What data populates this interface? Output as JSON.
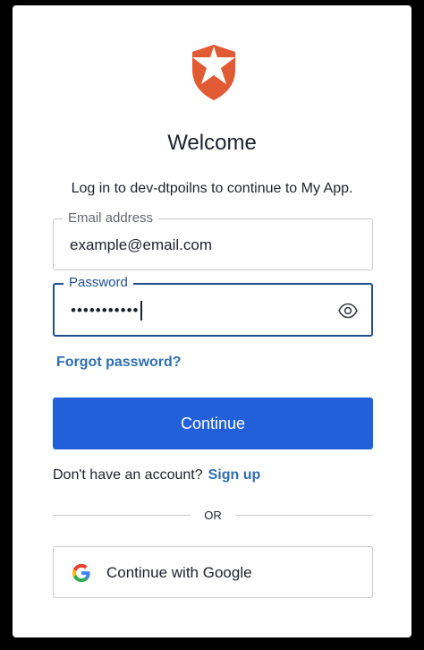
{
  "brand": {
    "logo_icon": "shield-star-icon",
    "logo_color": "#e05a34"
  },
  "header": {
    "title": "Welcome",
    "subtitle": "Log in to dev-dtpoilns to continue to My App."
  },
  "form": {
    "email": {
      "label": "Email address",
      "value": "example@email.com"
    },
    "password": {
      "label": "Password",
      "masked_value": "•••••••••••",
      "toggle_icon": "eye-icon"
    },
    "forgot_label": "Forgot password?",
    "continue_label": "Continue",
    "accent_color": "#2260d9"
  },
  "signup": {
    "prompt": "Don't have an account?",
    "link_label": "Sign up"
  },
  "divider": {
    "label": "OR"
  },
  "social": {
    "google_label": "Continue with Google",
    "google_icon": "google-icon"
  }
}
